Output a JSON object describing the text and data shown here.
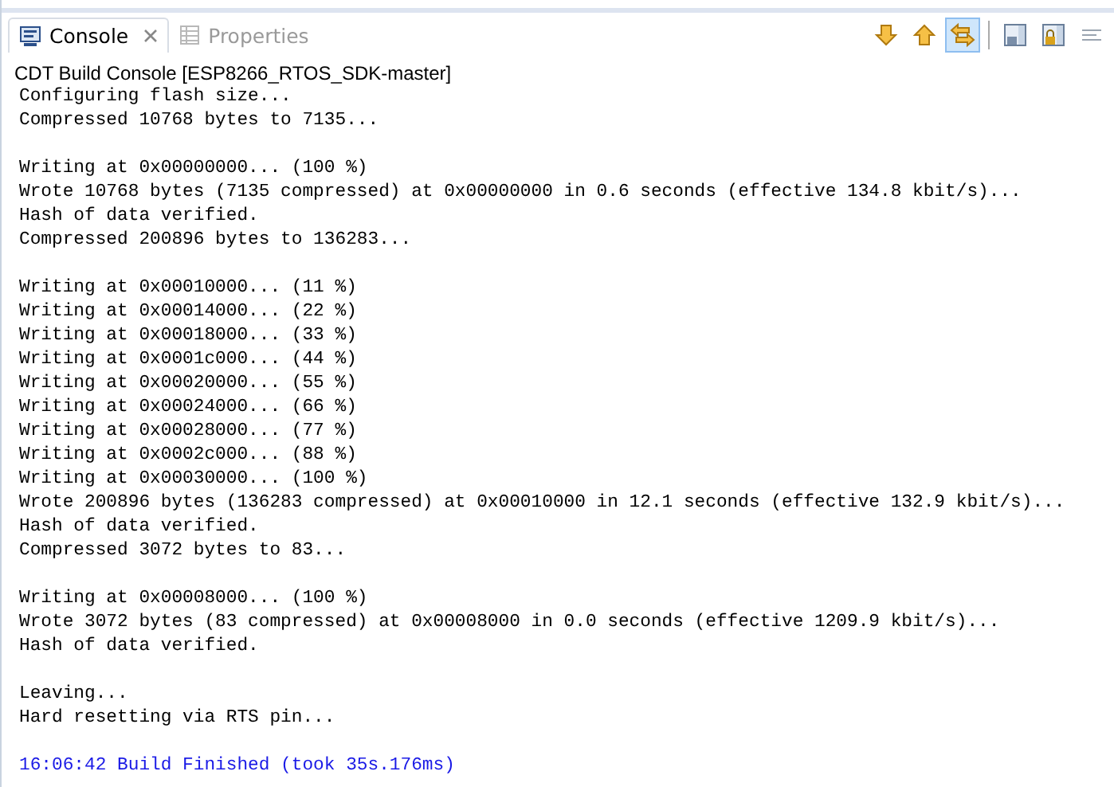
{
  "tabs": [
    {
      "label": "Console",
      "kind": "console",
      "selected": true,
      "closable": true
    },
    {
      "label": "Properties",
      "kind": "properties",
      "selected": false,
      "closable": false
    }
  ],
  "toolbar": [
    {
      "kind": "arrow-down",
      "selected": false
    },
    {
      "kind": "arrow-up",
      "selected": false
    },
    {
      "kind": "swap",
      "selected": true
    },
    {
      "kind": "separator"
    },
    {
      "kind": "pin-console",
      "selected": false
    },
    {
      "kind": "lock-console",
      "selected": false
    },
    {
      "kind": "menu",
      "selected": false
    }
  ],
  "console_title": "CDT Build Console [ESP8266_RTOS_SDK-master]",
  "lines": [
    {
      "kind": "output",
      "text": "Configuring flash size..."
    },
    {
      "kind": "output",
      "text": "Compressed 10768 bytes to 7135..."
    },
    {
      "kind": "blank"
    },
    {
      "kind": "output",
      "text": "Writing at 0x00000000... (100 %)"
    },
    {
      "kind": "output",
      "text": "Wrote 10768 bytes (7135 compressed) at 0x00000000 in 0.6 seconds (effective 134.8 kbit/s)..."
    },
    {
      "kind": "output",
      "text": "Hash of data verified."
    },
    {
      "kind": "output",
      "text": "Compressed 200896 bytes to 136283..."
    },
    {
      "kind": "blank"
    },
    {
      "kind": "output",
      "text": "Writing at 0x00010000... (11 %)"
    },
    {
      "kind": "output",
      "text": "Writing at 0x00014000... (22 %)"
    },
    {
      "kind": "output",
      "text": "Writing at 0x00018000... (33 %)"
    },
    {
      "kind": "output",
      "text": "Writing at 0x0001c000... (44 %)"
    },
    {
      "kind": "output",
      "text": "Writing at 0x00020000... (55 %)"
    },
    {
      "kind": "output",
      "text": "Writing at 0x00024000... (66 %)"
    },
    {
      "kind": "output",
      "text": "Writing at 0x00028000... (77 %)"
    },
    {
      "kind": "output",
      "text": "Writing at 0x0002c000... (88 %)"
    },
    {
      "kind": "output",
      "text": "Writing at 0x00030000... (100 %)"
    },
    {
      "kind": "output",
      "text": "Wrote 200896 bytes (136283 compressed) at 0x00010000 in 12.1 seconds (effective 132.9 kbit/s)..."
    },
    {
      "kind": "output",
      "text": "Hash of data verified."
    },
    {
      "kind": "output",
      "text": "Compressed 3072 bytes to 83..."
    },
    {
      "kind": "blank"
    },
    {
      "kind": "output",
      "text": "Writing at 0x00008000... (100 %)"
    },
    {
      "kind": "output",
      "text": "Wrote 3072 bytes (83 compressed) at 0x00008000 in 0.0 seconds (effective 1209.9 kbit/s)..."
    },
    {
      "kind": "output",
      "text": "Hash of data verified."
    },
    {
      "kind": "blank"
    },
    {
      "kind": "output",
      "text": "Leaving..."
    },
    {
      "kind": "output",
      "text": "Hard resetting via RTS pin..."
    },
    {
      "kind": "blank"
    },
    {
      "kind": "status",
      "text": "16:06:42 Build Finished (took 35s.176ms)"
    }
  ]
}
